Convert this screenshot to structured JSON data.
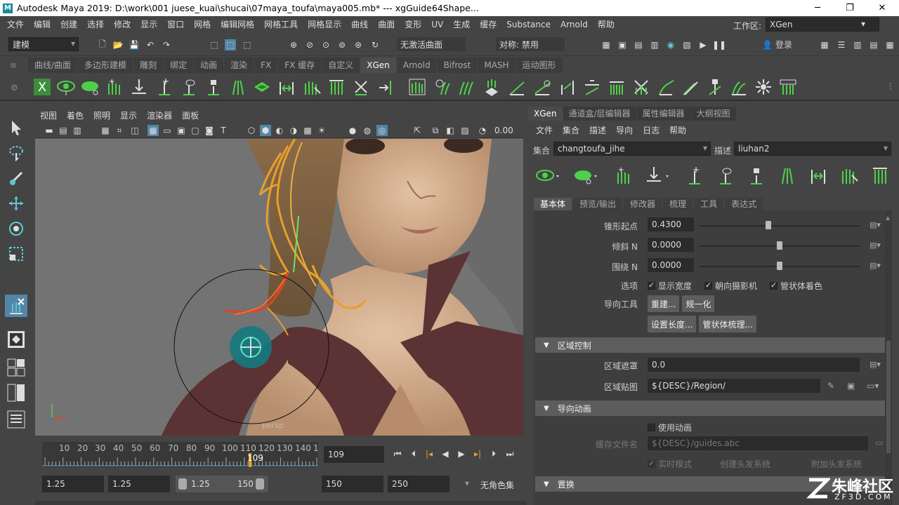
{
  "title": "Autodesk Maya 2019: D:\\work\\001 juese_kuai\\shucai\\07maya_toufa\\maya005.mb*  ---  xgGuide64Shape...",
  "window_controls": {
    "minimize": "─",
    "maximize": "❐",
    "close": "✕"
  },
  "menu": [
    "文件",
    "编辑",
    "创建",
    "选择",
    "修改",
    "显示",
    "窗口",
    "网格",
    "编辑网格",
    "网格工具",
    "网格显示",
    "曲线",
    "曲面",
    "变形",
    "UV",
    "生成",
    "缓存",
    "Substance",
    "Arnold",
    "帮助"
  ],
  "workspace": {
    "label": "工作区:",
    "value": "XGen"
  },
  "status_line": {
    "mode": "建模",
    "live_surface": "无激活曲面",
    "symmetry": "对称: 禁用",
    "login": "登录"
  },
  "shelf_tabs": [
    "曲线/曲面",
    "多边形建模",
    "雕刻",
    "绑定",
    "动画",
    "渲染",
    "FX",
    "FX 缓存",
    "自定义",
    "XGen",
    "Arnold",
    "Bifrost",
    "MASH",
    "运动图形"
  ],
  "shelf_active": "XGen",
  "viewport": {
    "menu": [
      "视图",
      "着色",
      "照明",
      "显示",
      "渲染器",
      "面板"
    ],
    "value": "0.00",
    "camera": "persp"
  },
  "timeline": {
    "ticks": [
      "10",
      "20",
      "30",
      "40",
      "50",
      "60",
      "70",
      "80",
      "90",
      "100",
      "110",
      "120",
      "130",
      "140",
      "1"
    ],
    "current": "109",
    "current_field": "109"
  },
  "range": {
    "start": "1.25",
    "start2": "1.25",
    "slider_start": "1.25",
    "slider_end": "150",
    "end": "150",
    "end2": "250",
    "charset": "无角色集"
  },
  "panel": {
    "tabs": [
      "XGen",
      "通道盒/层编辑器",
      "属性编辑器",
      "大纲视图"
    ],
    "menu": [
      "文件",
      "集合",
      "描述",
      "导向",
      "日志",
      "帮助"
    ],
    "collection_label": "集合",
    "collection_value": "changtoufa_jihe",
    "description_label": "描述",
    "description_value": "liuhan2",
    "subtabs": [
      "基本体",
      "预览/输出",
      "修改器",
      "梳理",
      "工具",
      "表达式"
    ],
    "attrs": [
      {
        "label": "锥形起点",
        "value": "0.4300",
        "level": 0.43
      },
      {
        "label": "倾斜 N",
        "value": "0.0000",
        "level": 0.5
      },
      {
        "label": "围绕 N",
        "value": "0.0000",
        "level": 0.5
      }
    ],
    "options_label": "选项",
    "options": [
      "显示宽度",
      "朝向摄影机",
      "管状体着色"
    ],
    "guide_tool_label": "导向工具",
    "guide_buttons": [
      "重建...",
      "规一化"
    ],
    "guide_buttons2": [
      "设置长度...",
      "管状体梳理..."
    ],
    "section_region": "区域控制",
    "region_mask_label": "区域遮罩",
    "region_mask_value": "0.0",
    "region_map_label": "区域贴图",
    "region_map_value": "${DESC}/Region/",
    "section_anim": "导向动画",
    "use_anim": "使用动画",
    "cache_label": "缓存文件名",
    "cache_value": "${DESC}/guides.abc",
    "realtime": "实时模式",
    "create_hair": "创建头发系统",
    "attach_hair": "附加头发系统",
    "section_replace": "置换"
  },
  "watermark": {
    "text": "朱峰社区",
    "url": "ZF3D.COM"
  },
  "colors": {
    "accent": "#5fc6d8",
    "green_icon": "#4fd04a",
    "hair": "#e8a028",
    "guide_red": "#e2431e"
  }
}
